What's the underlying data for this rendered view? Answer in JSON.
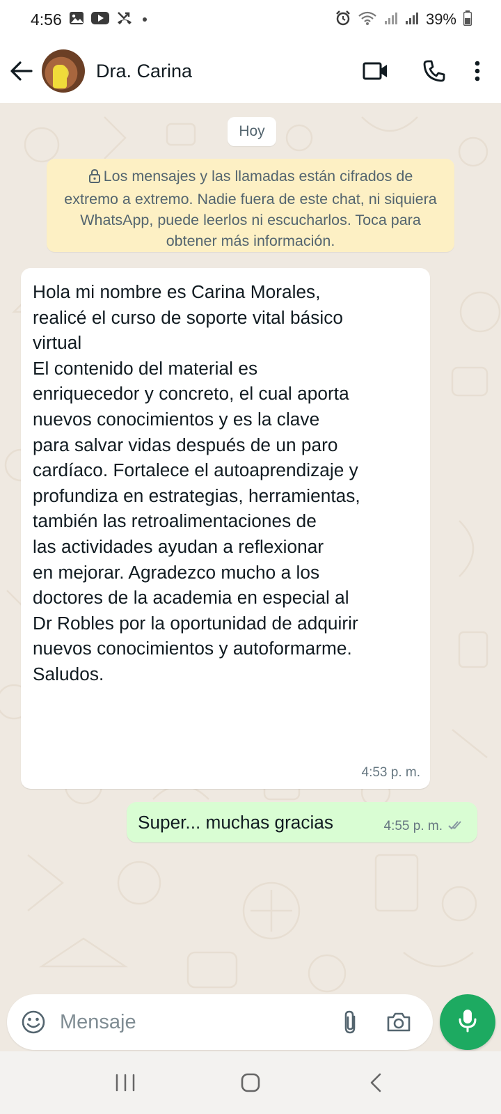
{
  "status_bar": {
    "time": "4:56",
    "battery": "39%",
    "icons": [
      "gallery-icon",
      "youtube-icon",
      "missed-call-icon",
      "alarm-icon",
      "wifi-icon",
      "signal-icon",
      "signal-icon",
      "battery-icon"
    ]
  },
  "header": {
    "contact_name": "Dra. Carina",
    "icons": [
      "back-arrow-icon",
      "video-call-icon",
      "voice-call-icon",
      "more-vert-icon"
    ]
  },
  "chat": {
    "day_label": "Hoy",
    "encryption_notice": "Los mensajes y las llamadas están cifrados de extremo a extremo. Nadie fuera de este chat, ni siquiera WhatsApp, puede leerlos ni escucharlos. Toca para obtener más información.",
    "messages": [
      {
        "direction": "incoming",
        "text": "Hola mi nombre es Carina Morales,\nrealicé el curso de soporte vital básico\nvirtual\nEl contenido del material es\nenriquecedor y concreto, el cual aporta\nnuevos conocimientos y es la clave\npara salvar vidas después de un paro\ncardíaco.  Fortalece el autoaprendizaje y\nprofundiza en estrategias, herramientas,\ntambién las retroalimentaciones de\nlas actividades ayudan a reflexionar\nen mejorar. Agradezco mucho a los\ndoctores de la academia en especial al\nDr Robles por la oportunidad de adquirir\nnuevos conocimientos y autoformarme.\nSaludos.",
        "time": "4:53 p. m."
      },
      {
        "direction": "outgoing",
        "text": "Super... muchas gracias",
        "time": "4:55 p. m.",
        "status": "read"
      }
    ]
  },
  "composer": {
    "placeholder": "Mensaje",
    "icons": [
      "emoji-icon",
      "attach-icon",
      "camera-icon",
      "mic-icon"
    ]
  },
  "nav_bar": {
    "icons": [
      "recents-icon",
      "home-icon",
      "back-icon"
    ]
  },
  "colors": {
    "chat_background": "#efe9e1",
    "incoming_bubble": "#ffffff",
    "outgoing_bubble": "#d9fdd3",
    "notice_background": "#fdf0c4",
    "accent_green": "#1daa61"
  }
}
